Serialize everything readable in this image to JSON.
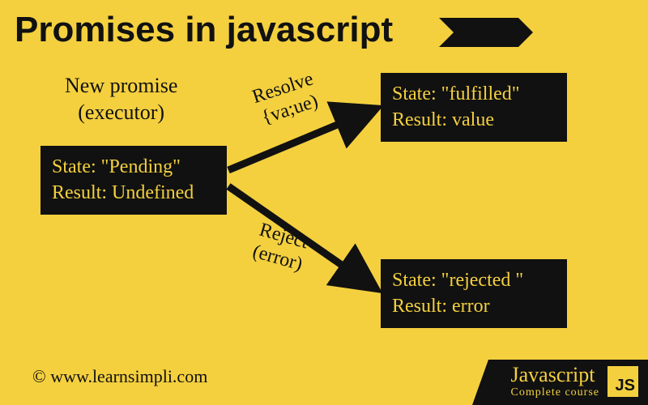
{
  "title": "Promises in javascript",
  "newPromiseLabel": "New promise\n(executor)",
  "boxes": {
    "pending": {
      "line1": "State: \"Pending\"",
      "line2": "Result: Undefined"
    },
    "fulfilled": {
      "line1": "State: \"fulfilled\"",
      "line2": "Result: value"
    },
    "rejected": {
      "line1": "State: \"rejected \"",
      "line2": "Result: error"
    }
  },
  "arrows": {
    "resolve": {
      "label": "Resolve\n{va;ue)"
    },
    "reject": {
      "label": "Reject\n(error)"
    }
  },
  "footer": "© www.learnsimpli.com",
  "brand": {
    "title": "Javascript",
    "subtitle": "Complete course",
    "badge": "JS"
  },
  "chart_data": {
    "type": "flow-diagram",
    "title": "Promises in javascript",
    "nodes": [
      {
        "id": "pending",
        "label": "New promise (executor)",
        "state": "Pending",
        "result": "Undefined"
      },
      {
        "id": "fulfilled",
        "state": "fulfilled",
        "result": "value"
      },
      {
        "id": "rejected",
        "state": "rejected",
        "result": "error"
      }
    ],
    "edges": [
      {
        "from": "pending",
        "to": "fulfilled",
        "label": "Resolve {va;ue)"
      },
      {
        "from": "pending",
        "to": "rejected",
        "label": "Reject (error)"
      }
    ]
  }
}
